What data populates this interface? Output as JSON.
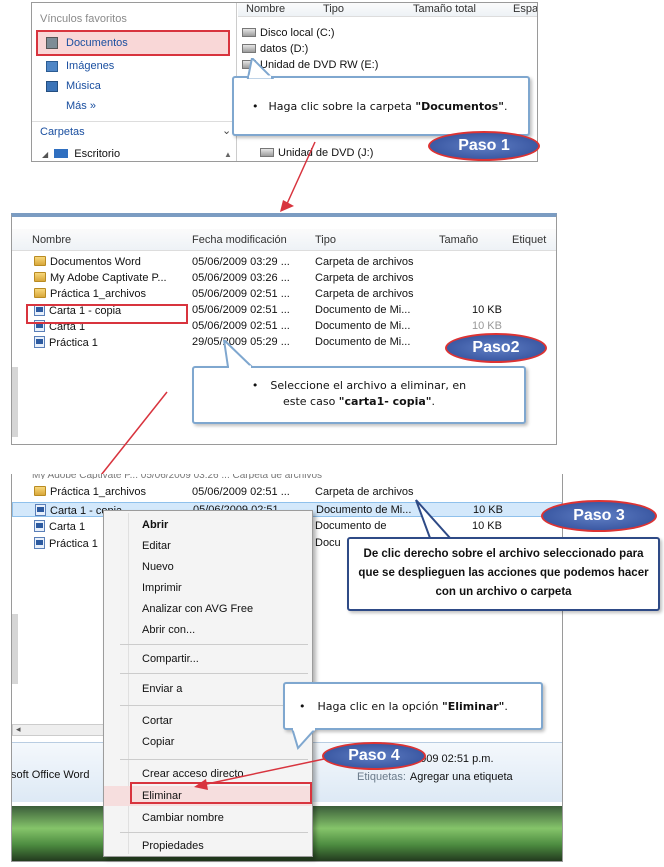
{
  "panel1": {
    "nav_header": "Vínculos favoritos",
    "favorites": [
      "Documentos",
      "Imágenes",
      "Música"
    ],
    "more": "Más »",
    "folders_label": "Carpetas",
    "tree_item": "Escritorio",
    "columns": [
      "Nombre",
      "Tipo",
      "Tamaño total",
      "Espa"
    ],
    "drives": [
      "Disco local (C:)",
      "datos (D:)",
      "Unidad de DVD RW (E:)",
      "Unidad de DVD (J:)"
    ],
    "callout": {
      "prefix": "Haga clic sobre la carpeta ",
      "bold": "\"Documentos\"",
      "suffix": "."
    },
    "step": "Paso 1"
  },
  "panel2": {
    "columns": [
      "Nombre",
      "Fecha modificación",
      "Tipo",
      "Tamaño",
      "Etiquet"
    ],
    "rows": [
      {
        "name": "Documentos Word",
        "date": "05/06/2009 03:29 ...",
        "type": "Carpeta de archivos",
        "size": ""
      },
      {
        "name": "My Adobe Captivate P...",
        "date": "05/06/2009 03:26 ...",
        "type": "Carpeta de archivos",
        "size": ""
      },
      {
        "name": "Práctica 1_archivos",
        "date": "05/06/2009 02:51 ...",
        "type": "Carpeta de archivos",
        "size": ""
      },
      {
        "name": "Carta 1 - copia",
        "date": "05/06/2009 02:51 ...",
        "type": "Documento de Mi...",
        "size": "10 KB"
      },
      {
        "name": "Carta 1",
        "date": "05/06/2009 02:51 ...",
        "type": "Documento de Mi...",
        "size": "10 KB"
      },
      {
        "name": "Práctica 1",
        "date": "29/05/2009 05:29 ...",
        "type": "Documento de Mi...",
        "size": ""
      }
    ],
    "callout": {
      "line1": "Seleccione el  archivo a eliminar, en",
      "line2_prefix": "este caso ",
      "line2_bold": "\"carta1- copia\"",
      "line2_suffix": "."
    },
    "step": "Paso2"
  },
  "panel3": {
    "rows": [
      {
        "name": "Práctica 1_archivos",
        "date": "05/06/2009 02:51 ...",
        "type": "Carpeta de archivos",
        "size": ""
      },
      {
        "name": "Carta 1 - copia",
        "date": "05/06/2009 02:51",
        "type": "Documento de Mi...",
        "size": "10 KB"
      },
      {
        "name": "Carta 1",
        "date": "",
        "type": "Documento de",
        "size": "10 KB"
      },
      {
        "name": "Práctica 1",
        "date": "",
        "type": "Docu",
        "size": ""
      }
    ],
    "context_menu": [
      "Abrir",
      "Editar",
      "Nuevo",
      "Imprimir",
      "Analizar con AVG Free",
      "Abrir con...",
      "Compartir...",
      "Enviar a",
      "Cortar",
      "Copiar",
      "Crear acceso directo",
      "Eliminar",
      "Cambiar nombre",
      "Propiedades"
    ],
    "callout3": "De clic derecho sobre el archivo seleccionado para que se desplieguen las acciones que podemos hacer con un archivo o carpeta",
    "step3": "Paso 3",
    "callout4": {
      "prefix": "Haga clic en la opción ",
      "bold": "\"Eliminar\"",
      "suffix": "."
    },
    "step4": "Paso 4",
    "details": {
      "app": "soft Office Word",
      "date_partial": "2009 02:51 p.m.",
      "tags_label": "Etiquetas:",
      "tags_value": "Agregar una etiqueta"
    }
  },
  "colors": {
    "highlight_red": "#d8343e",
    "pill_blue": "#3b5aa8",
    "callout_border": "#7fa7cf",
    "selection": "#cde8ff"
  }
}
